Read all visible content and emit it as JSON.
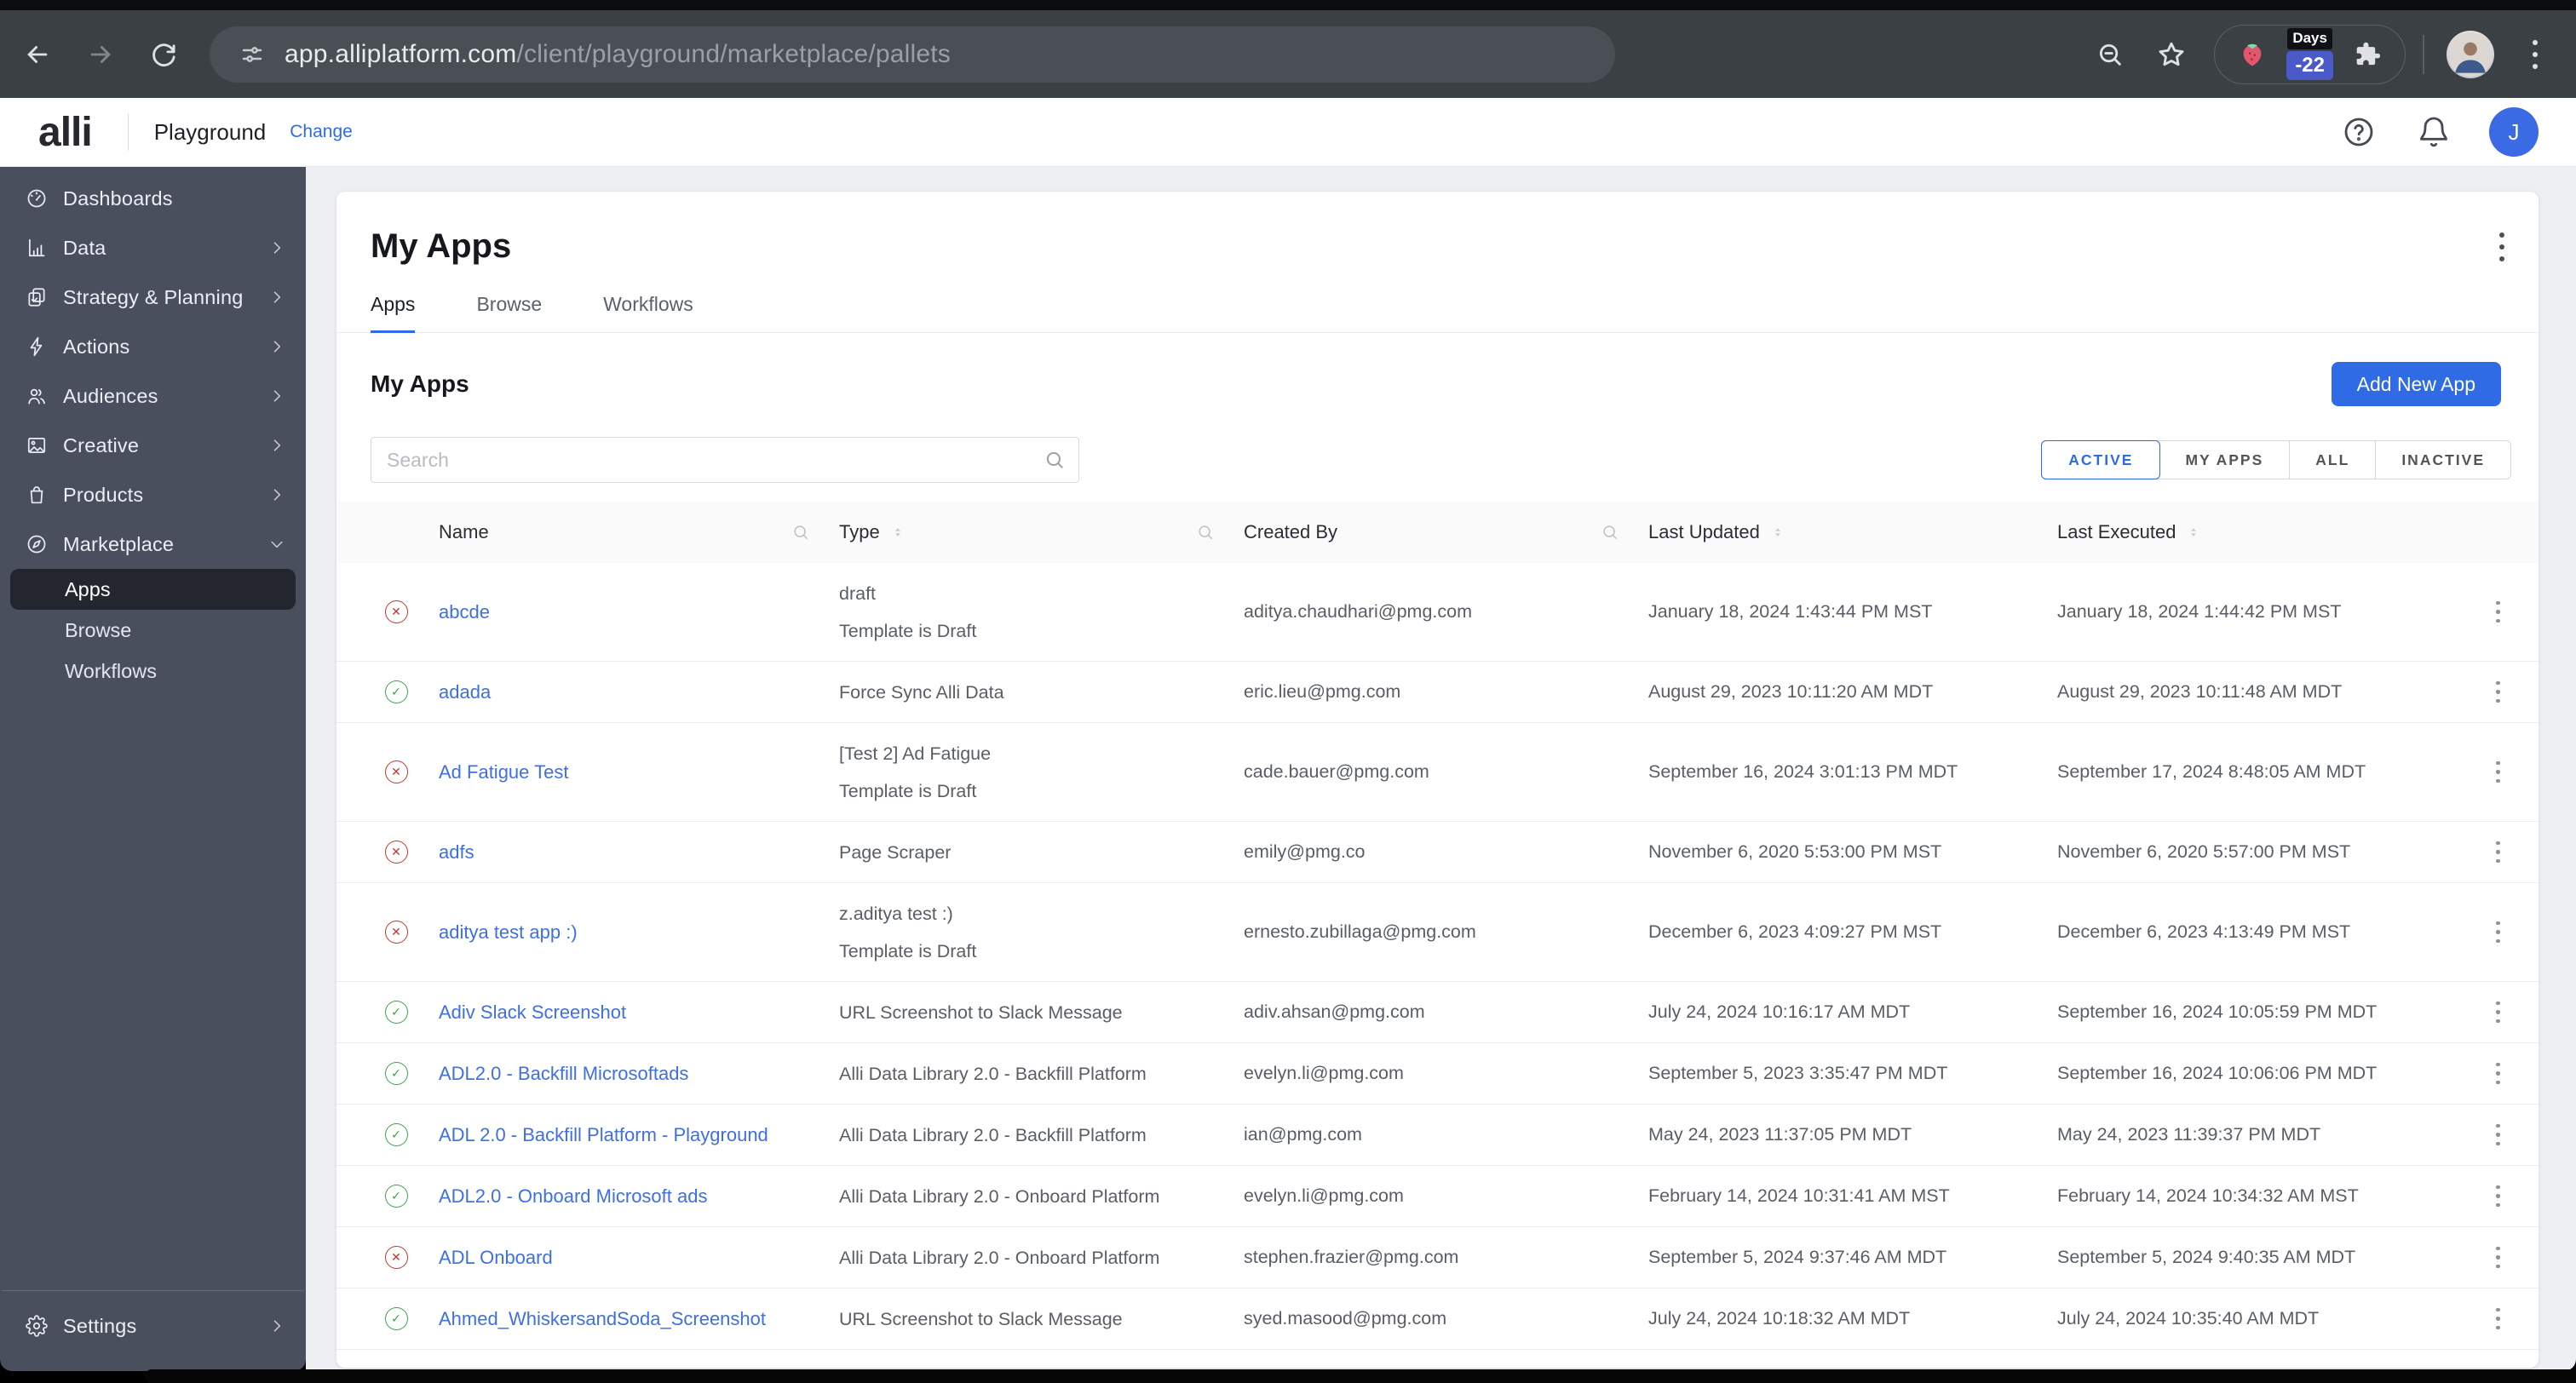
{
  "browser": {
    "url_domain": "app.alliplatform.com",
    "url_path": "/client/playground/marketplace/pallets",
    "extension_badge": {
      "top": "Days",
      "bottom": "-22"
    }
  },
  "app_header": {
    "logo": "alli",
    "workspace": "Playground",
    "change_link": "Change",
    "avatar_initial": "J"
  },
  "sidebar": {
    "items": [
      {
        "label": "Dashboards",
        "icon": "dashboard-gauge-icon",
        "chevron": null
      },
      {
        "label": "Data",
        "icon": "bar-chart-icon",
        "chevron": "right"
      },
      {
        "label": "Strategy & Planning",
        "icon": "clipboard-icon",
        "chevron": "right"
      },
      {
        "label": "Actions",
        "icon": "lightning-icon",
        "chevron": "right"
      },
      {
        "label": "Audiences",
        "icon": "people-icon",
        "chevron": "right"
      },
      {
        "label": "Creative",
        "icon": "image-icon",
        "chevron": "right"
      },
      {
        "label": "Products",
        "icon": "shopping-bag-icon",
        "chevron": "right"
      },
      {
        "label": "Marketplace",
        "icon": "compass-icon",
        "chevron": "down",
        "submenu": [
          {
            "label": "Apps",
            "selected": true
          },
          {
            "label": "Browse",
            "selected": false
          },
          {
            "label": "Workflows",
            "selected": false
          }
        ]
      }
    ],
    "footer_item": {
      "label": "Settings",
      "icon": "gear-icon",
      "chevron": "right"
    }
  },
  "main": {
    "page_title": "My Apps",
    "tabs": [
      {
        "label": "Apps",
        "active": true
      },
      {
        "label": "Browse",
        "active": false
      },
      {
        "label": "Workflows",
        "active": false
      }
    ],
    "section_title": "My Apps",
    "add_button_label": "Add New App",
    "search_placeholder": "Search",
    "filters": [
      {
        "label": "ACTIVE",
        "active": true
      },
      {
        "label": "MY APPS",
        "active": false
      },
      {
        "label": "ALL",
        "active": false
      },
      {
        "label": "INACTIVE",
        "active": false
      }
    ],
    "table": {
      "columns": [
        {
          "label": "Name",
          "sort": false,
          "search": true
        },
        {
          "label": "Type",
          "sort": true,
          "search": true
        },
        {
          "label": "Created By",
          "sort": false,
          "search": true
        },
        {
          "label": "Last Updated",
          "sort": true,
          "search": false
        },
        {
          "label": "Last Executed",
          "sort": true,
          "search": false
        }
      ],
      "rows": [
        {
          "status": "error",
          "name": "abcde",
          "type_lines": [
            "draft",
            "Template is Draft"
          ],
          "created_by": "aditya.chaudhari@pmg.com",
          "last_updated": "January 18, 2024 1:43:44 PM MST",
          "last_executed": "January 18, 2024 1:44:42 PM MST"
        },
        {
          "status": "ok",
          "name": "adada",
          "type_lines": [
            "Force Sync Alli Data"
          ],
          "created_by": "eric.lieu@pmg.com",
          "last_updated": "August 29, 2023 10:11:20 AM MDT",
          "last_executed": "August 29, 2023 10:11:48 AM MDT"
        },
        {
          "status": "error",
          "name": "Ad Fatigue Test",
          "type_lines": [
            "[Test 2] Ad Fatigue",
            "Template is Draft"
          ],
          "created_by": "cade.bauer@pmg.com",
          "last_updated": "September 16, 2024 3:01:13 PM MDT",
          "last_executed": "September 17, 2024 8:48:05 AM MDT"
        },
        {
          "status": "error",
          "name": "adfs",
          "type_lines": [
            "Page Scraper"
          ],
          "created_by": "emily@pmg.co",
          "last_updated": "November 6, 2020 5:53:00 PM MST",
          "last_executed": "November 6, 2020 5:57:00 PM MST"
        },
        {
          "status": "error",
          "name": "aditya test app :)",
          "type_lines": [
            "z.aditya test :)",
            "Template is Draft"
          ],
          "created_by": "ernesto.zubillaga@pmg.com",
          "last_updated": "December 6, 2023 4:09:27 PM MST",
          "last_executed": "December 6, 2023 4:13:49 PM MST"
        },
        {
          "status": "ok",
          "name": "Adiv Slack Screenshot",
          "type_lines": [
            "URL Screenshot to Slack Message"
          ],
          "created_by": "adiv.ahsan@pmg.com",
          "last_updated": "July 24, 2024 10:16:17 AM MDT",
          "last_executed": "September 16, 2024 10:05:59 PM MDT"
        },
        {
          "status": "ok",
          "name": "ADL2.0 - Backfill Microsoftads",
          "type_lines": [
            "Alli Data Library 2.0 - Backfill Platform"
          ],
          "created_by": "evelyn.li@pmg.com",
          "last_updated": "September 5, 2023 3:35:47 PM MDT",
          "last_executed": "September 16, 2024 10:06:06 PM MDT"
        },
        {
          "status": "ok",
          "name": "ADL 2.0 - Backfill Platform - Playground",
          "type_lines": [
            "Alli Data Library 2.0 - Backfill Platform"
          ],
          "created_by": "ian@pmg.com",
          "last_updated": "May 24, 2023 11:37:05 PM MDT",
          "last_executed": "May 24, 2023 11:39:37 PM MDT"
        },
        {
          "status": "ok",
          "name": "ADL2.0 - Onboard Microsoft ads",
          "type_lines": [
            "Alli Data Library 2.0 - Onboard Platform"
          ],
          "created_by": "evelyn.li@pmg.com",
          "last_updated": "February 14, 2024 10:31:41 AM MST",
          "last_executed": "February 14, 2024 10:34:32 AM MST"
        },
        {
          "status": "error",
          "name": "ADL Onboard",
          "type_lines": [
            "Alli Data Library 2.0 - Onboard Platform"
          ],
          "created_by": "stephen.frazier@pmg.com",
          "last_updated": "September 5, 2024 9:37:46 AM MDT",
          "last_executed": "September 5, 2024 9:40:35 AM MDT"
        },
        {
          "status": "ok",
          "name": "Ahmed_WhiskersandSoda_Screenshot",
          "type_lines": [
            "URL Screenshot to Slack Message"
          ],
          "created_by": "syed.masood@pmg.com",
          "last_updated": "July 24, 2024 10:18:32 AM MDT",
          "last_executed": "July 24, 2024 10:35:40 AM MDT"
        }
      ]
    }
  },
  "colors": {
    "accent": "#2F6BE4",
    "link": "#3E6FE3",
    "status_ok": "#43A047",
    "status_error": "#C0392B",
    "sidebar_bg": "#4A4F5E"
  }
}
